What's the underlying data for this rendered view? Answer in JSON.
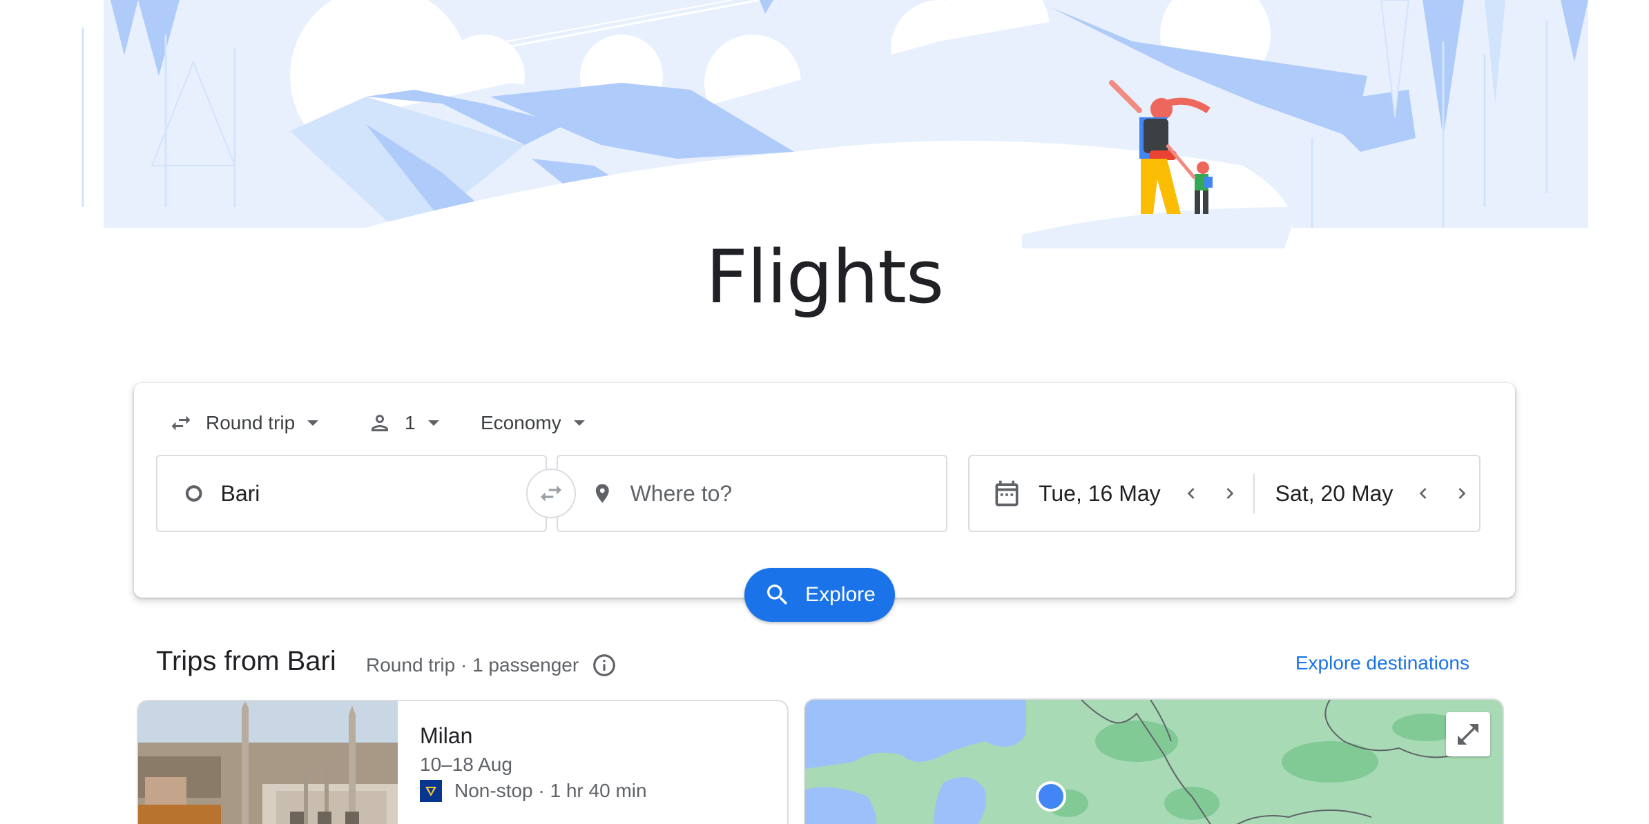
{
  "page": {
    "title": "Flights"
  },
  "search": {
    "trip_type": "Round trip",
    "passengers": "1",
    "cabin_class": "Economy",
    "origin_value": "Bari",
    "destination_placeholder": "Where to?",
    "depart_date": "Tue, 16 May",
    "return_date": "Sat, 20 May",
    "explore_label": "Explore"
  },
  "trips": {
    "title": "Trips from Bari",
    "subtitle": "Round trip · 1 passenger",
    "explore_link": "Explore destinations",
    "items": [
      {
        "city": "Milan",
        "dates": "10–18 Aug",
        "flight_info": "Non-stop · 1 hr 40 min",
        "airline_icon": "ryanair-logo-icon"
      }
    ]
  },
  "colors": {
    "accent": "#1a73e8",
    "hero_light": "#e8f0fe",
    "hero_mid": "#aecbfa",
    "map_land": "#a8dab5",
    "map_water": "#9cc0f9"
  }
}
